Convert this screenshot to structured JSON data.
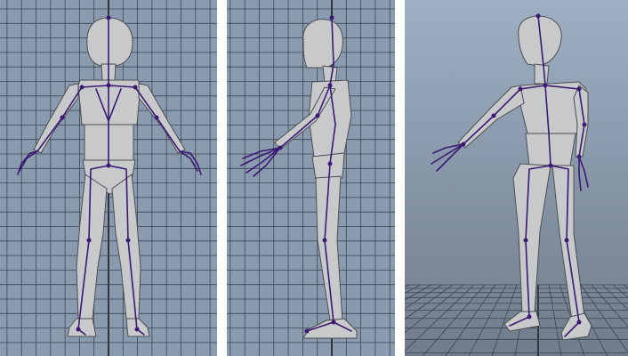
{
  "colors": {
    "viewport_bg": "#8a9bb0",
    "grid_line": "#3d4650",
    "grid_axis": "#161b20",
    "divider": "#ffffff",
    "mesh_fill": "#c8c9cb",
    "mesh_light": "#e6e7e8",
    "mesh_dark": "#8e9094",
    "mesh_outline": "#4c4e52",
    "joint": "#3a1a73",
    "persp_bg_top": "#9fb0c4",
    "persp_bg_bottom": "#6f7c8b"
  },
  "viewports": [
    {
      "name": "front-viewport",
      "view": "front"
    },
    {
      "name": "side-viewport",
      "view": "side"
    },
    {
      "name": "perspective-viewport",
      "view": "perspective"
    }
  ]
}
